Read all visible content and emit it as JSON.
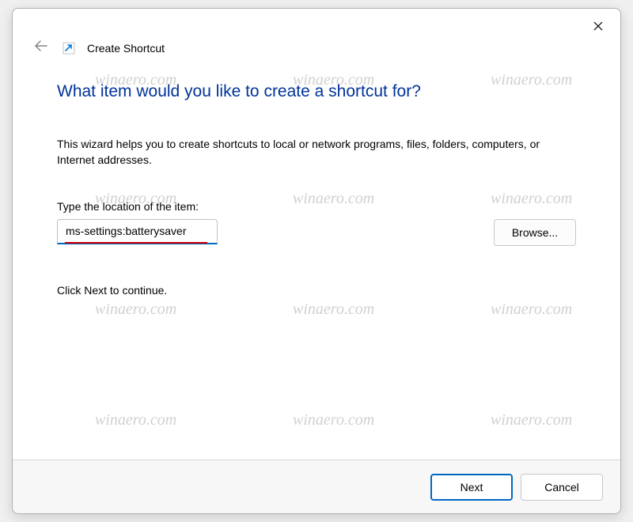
{
  "header": {
    "title": "Create Shortcut"
  },
  "main": {
    "heading": "What item would you like to create a shortcut for?",
    "description": "This wizard helps you to create shortcuts to local or network programs, files, folders, computers, or Internet addresses.",
    "field_label": "Type the location of the item:",
    "location_value": "ms-settings:batterysaver",
    "browse_label": "Browse...",
    "continue_text": "Click Next to continue."
  },
  "footer": {
    "next_label": "Next",
    "cancel_label": "Cancel"
  },
  "watermark": {
    "text": "winaero.com"
  }
}
